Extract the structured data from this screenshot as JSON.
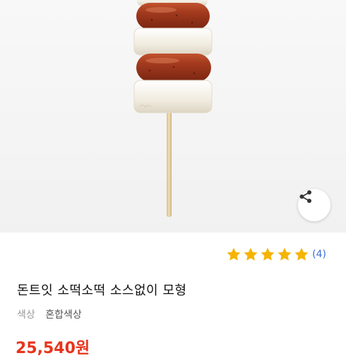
{
  "product": {
    "title": "돈트잇 소떡소떡 소스없이 모형",
    "option_label": "색상",
    "option_value": "혼합색상",
    "price": "25,540원"
  },
  "rating": {
    "stars": 5,
    "review_count": "(4)",
    "star_color": "#f5b400",
    "count_color": "#3b6fd8"
  },
  "icons": {
    "share": "share-icon"
  },
  "colors": {
    "price": "#e8341c",
    "sausage": "#a2391e",
    "rice_cake": "#f2ede2",
    "stick": "#e6d2a6"
  }
}
